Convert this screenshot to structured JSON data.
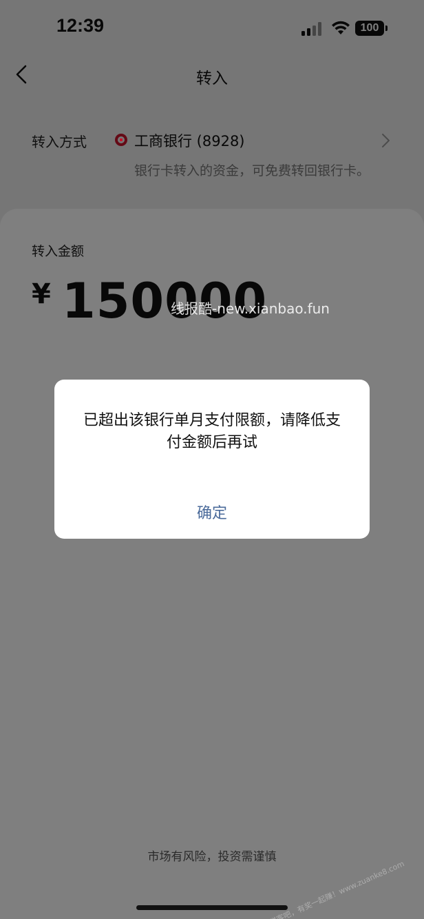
{
  "status_bar": {
    "time": "12:39",
    "battery": "100",
    "signal_icon": "cellular-signal-icon",
    "wifi_icon": "wifi-icon"
  },
  "nav": {
    "back_icon": "chevron-left-icon",
    "title": "转入"
  },
  "transfer_method": {
    "label": "转入方式",
    "bank_icon": "icbc-bank-logo-icon",
    "bank_name": "工商银行 (8928)",
    "chevron_icon": "chevron-right-icon",
    "note": "银行卡转入的资金，可免费转回银行卡。"
  },
  "amount": {
    "label": "转入金额",
    "currency": "¥",
    "value": "150000"
  },
  "watermark": "线报酷-new.xianbao.fun",
  "corner_watermark": "赚客吧，有奖一起赚！www.zuanke8.com",
  "risk_note": "市场有风险，投资需谨慎",
  "dialog": {
    "message": "已超出该银行单月支付限额，请降低支付金额后再试",
    "confirm_label": "确定"
  },
  "colors": {
    "overlay": "#000000",
    "confirm_text": "#4a6a9a",
    "bank_red": "#c8152d"
  }
}
